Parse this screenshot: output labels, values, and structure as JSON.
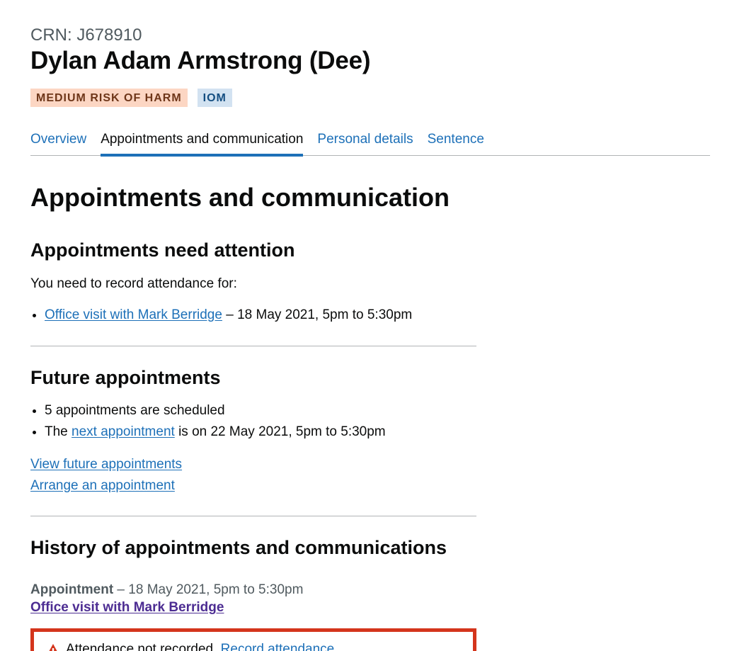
{
  "header": {
    "crn": "CRN: J678910",
    "name": "Dylan Adam Armstrong (Dee)",
    "tags": {
      "risk": "MEDIUM RISK OF HARM",
      "iom": "IOM"
    }
  },
  "tabs": [
    {
      "label": "Overview",
      "active": false
    },
    {
      "label": "Appointments and communication",
      "active": true
    },
    {
      "label": "Personal details",
      "active": false
    },
    {
      "label": "Sentence",
      "active": false
    }
  ],
  "main": {
    "title": "Appointments and communication",
    "attention": {
      "heading": "Appointments need attention",
      "intro": "You need to record attendance for:",
      "item_link": "Office visit with Mark Berridge",
      "item_suffix": " – 18 May 2021, 5pm to 5:30pm"
    },
    "future": {
      "heading": "Future appointments",
      "scheduled": "5 appointments are scheduled",
      "next_prefix": "The ",
      "next_link": "next appointment",
      "next_suffix": " is on 22 May 2021, 5pm to 5:30pm",
      "view_link": "View future appointments",
      "arrange_link": "Arrange an appointment"
    },
    "history": {
      "heading": "History of appointments and communications",
      "type": "Appointment",
      "when": " – 18 May 2021, 5pm to 5:30pm",
      "title_link": "Office visit with Mark Berridge",
      "warning_text": "Attendance not recorded. ",
      "warning_link": "Record attendance"
    }
  },
  "colors": {
    "link": "#1d70b8",
    "visited_link": "#4c2c92",
    "warning": "#d4351c",
    "risk_tag_bg": "#fcd6c3",
    "iom_tag_bg": "#d2e2f1"
  },
  "icons": {
    "warning": "warning-triangle-icon"
  }
}
